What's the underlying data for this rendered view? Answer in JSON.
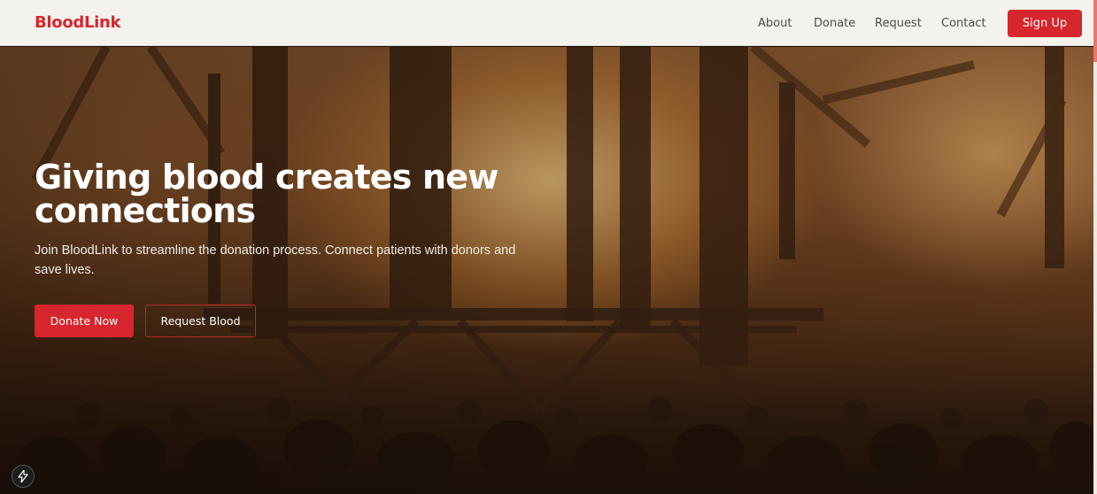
{
  "header": {
    "logo": "BloodLink",
    "nav": [
      "About",
      "Donate",
      "Request",
      "Contact"
    ],
    "signup_label": "Sign Up"
  },
  "hero": {
    "title": "Giving blood creates new connections",
    "subtitle": "Join BloodLink to streamline the donation process. Connect patients with donors and save lives.",
    "donate_label": "Donate Now",
    "request_label": "Request Blood",
    "background_icon": "festival-crowd-photo"
  },
  "badge": {
    "icon": "lightning-icon"
  },
  "colors": {
    "brand_red": "#d7262e",
    "nav_bg": "#f4f2ec",
    "hero_text": "#ffffff"
  }
}
